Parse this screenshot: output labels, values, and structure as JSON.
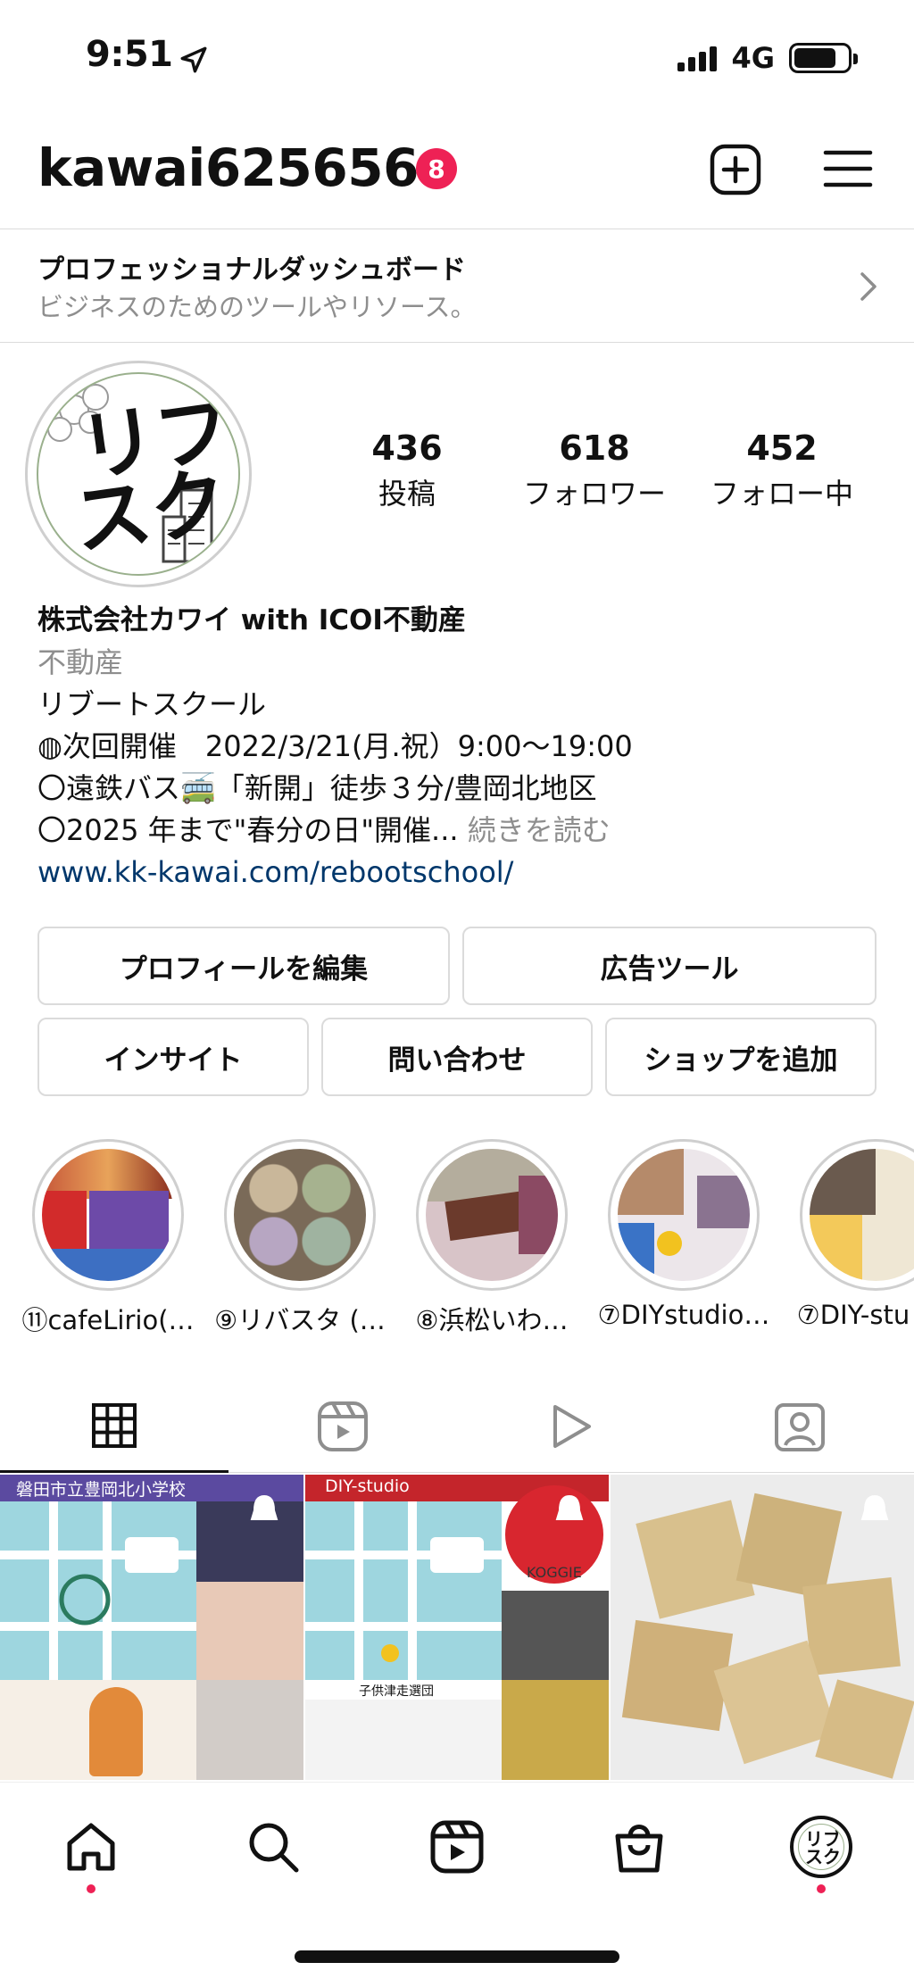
{
  "status_bar": {
    "time": "9:51",
    "network": "4G",
    "battery_level": 0.8
  },
  "header": {
    "username": "kawai625656",
    "notification_count": "8"
  },
  "dashboard": {
    "title": "プロフェッショナルダッシュボード",
    "subtitle": "ビジネスのためのツールやリソース。"
  },
  "stats": [
    {
      "value": "436",
      "label": "投稿"
    },
    {
      "value": "618",
      "label": "フォロワー"
    },
    {
      "value": "452",
      "label": "フォロー中"
    }
  ],
  "avatar": {
    "line1": "リブ",
    "line2": "スク"
  },
  "bio": {
    "name": "株式会社カワイ with ICOI不動産",
    "category": "不動産",
    "line1": "リブートスクール",
    "line2": "◍次回開催　2022/3/21(月.祝）9:00〜19:00",
    "line3": "〇遠鉄バス🚎「新開」徒歩３分/豊岡北地区",
    "line4": "〇2025 年まで\"春分の日\"開催...",
    "more": "続きを読む",
    "link": "www.kk-kawai.com/rebootschool/"
  },
  "buttons": {
    "edit_profile": "プロフィールを編集",
    "ad_tools": "広告ツール",
    "insights": "インサイト",
    "contact": "問い合わせ",
    "add_shop": "ショップを追加"
  },
  "highlights": [
    {
      "label": "⑪cafeLirio(…"
    },
    {
      "label": "⑨リバスタ (…"
    },
    {
      "label": "⑧浜松いわ…"
    },
    {
      "label": "⑦DIYstudio…"
    },
    {
      "label": "⑦DIY-stu"
    }
  ],
  "grid": {
    "post1_header": "磐田市立豊岡北小学校",
    "post2_header": "DIY-studio",
    "post2_logo": "KOGGIE",
    "post2_caption": "子供津走選団"
  },
  "colors": {
    "accent_link": "#00376b",
    "badge": "#ee2155",
    "border": "#dbdbdb",
    "muted": "#8e8e8e"
  },
  "icons": [
    "location-arrow-icon",
    "signal-icon",
    "battery-icon",
    "plus-square-icon",
    "menu-icon",
    "chevron-right-icon",
    "grid-icon",
    "reels-icon",
    "play-icon",
    "tagged-icon",
    "home-icon",
    "search-icon",
    "reels-nav-icon",
    "shop-icon",
    "multi-post-icon"
  ]
}
